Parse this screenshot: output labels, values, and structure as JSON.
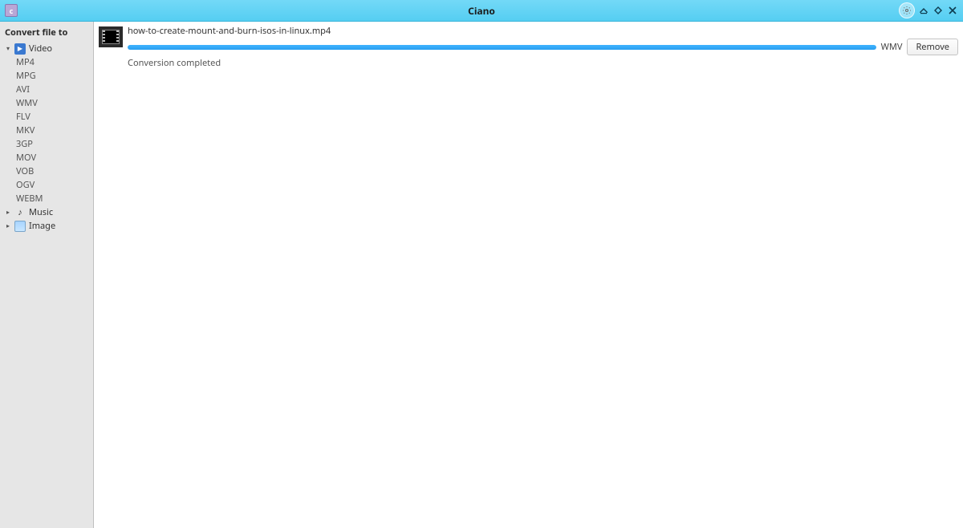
{
  "app": {
    "title": "Ciano"
  },
  "titlebar": {
    "icons": {
      "settings": "gear-icon",
      "minimize": "minimize-icon",
      "restore": "restore-icon",
      "close": "close-icon"
    }
  },
  "sidebar": {
    "heading": "Convert file to",
    "categories": [
      {
        "id": "video",
        "label": "Video",
        "expanded": true,
        "icon": "video-icon",
        "items": [
          "MP4",
          "MPG",
          "AVI",
          "WMV",
          "FLV",
          "MKV",
          "3GP",
          "MOV",
          "VOB",
          "OGV",
          "WEBM"
        ]
      },
      {
        "id": "music",
        "label": "Music",
        "expanded": false,
        "icon": "music-icon",
        "items": []
      },
      {
        "id": "image",
        "label": "Image",
        "expanded": false,
        "icon": "image-icon",
        "items": []
      }
    ]
  },
  "conversion": {
    "files": [
      {
        "name": "how-to-create-mount-and-burn-isos-in-linux.mp4",
        "target_format": "WMV",
        "progress_percent": 100,
        "status": "Conversion completed",
        "remove_label": "Remove"
      }
    ]
  }
}
